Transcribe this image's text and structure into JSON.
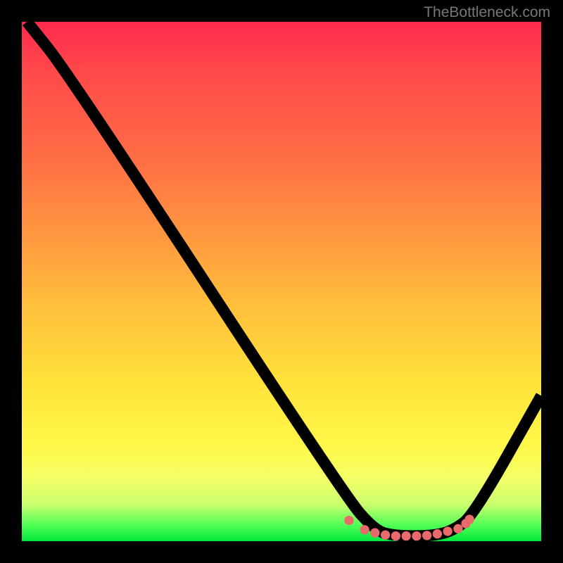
{
  "watermark": "TheBottleneck.com",
  "chart_data": {
    "type": "line",
    "title": "",
    "xlabel": "",
    "ylabel": "",
    "xlim": [
      0,
      100
    ],
    "ylim": [
      0,
      100
    ],
    "series": [
      {
        "name": "curve",
        "points": [
          {
            "x": 1,
            "y": 100
          },
          {
            "x": 9,
            "y": 90
          },
          {
            "x": 62,
            "y": 9
          },
          {
            "x": 68,
            "y": 2
          },
          {
            "x": 72,
            "y": 1
          },
          {
            "x": 79,
            "y": 1
          },
          {
            "x": 83,
            "y": 2
          },
          {
            "x": 87,
            "y": 5
          },
          {
            "x": 100,
            "y": 28
          }
        ]
      }
    ],
    "markers": {
      "name": "highlight-dots",
      "color": "#e86a6a",
      "points": [
        {
          "x": 63,
          "y": 4
        },
        {
          "x": 66,
          "y": 2.2
        },
        {
          "x": 68,
          "y": 1.6
        },
        {
          "x": 70,
          "y": 1.2
        },
        {
          "x": 72,
          "y": 1.0
        },
        {
          "x": 74,
          "y": 1.0
        },
        {
          "x": 76,
          "y": 1.0
        },
        {
          "x": 78,
          "y": 1.1
        },
        {
          "x": 80,
          "y": 1.4
        },
        {
          "x": 82,
          "y": 1.9
        },
        {
          "x": 84,
          "y": 2.4
        },
        {
          "x": 85.5,
          "y": 3.4
        },
        {
          "x": 86.2,
          "y": 4.2
        }
      ]
    },
    "background_gradient": {
      "top": "#ff2a4d",
      "mid": "#ffe33a",
      "bottom": "#00e63b"
    }
  }
}
